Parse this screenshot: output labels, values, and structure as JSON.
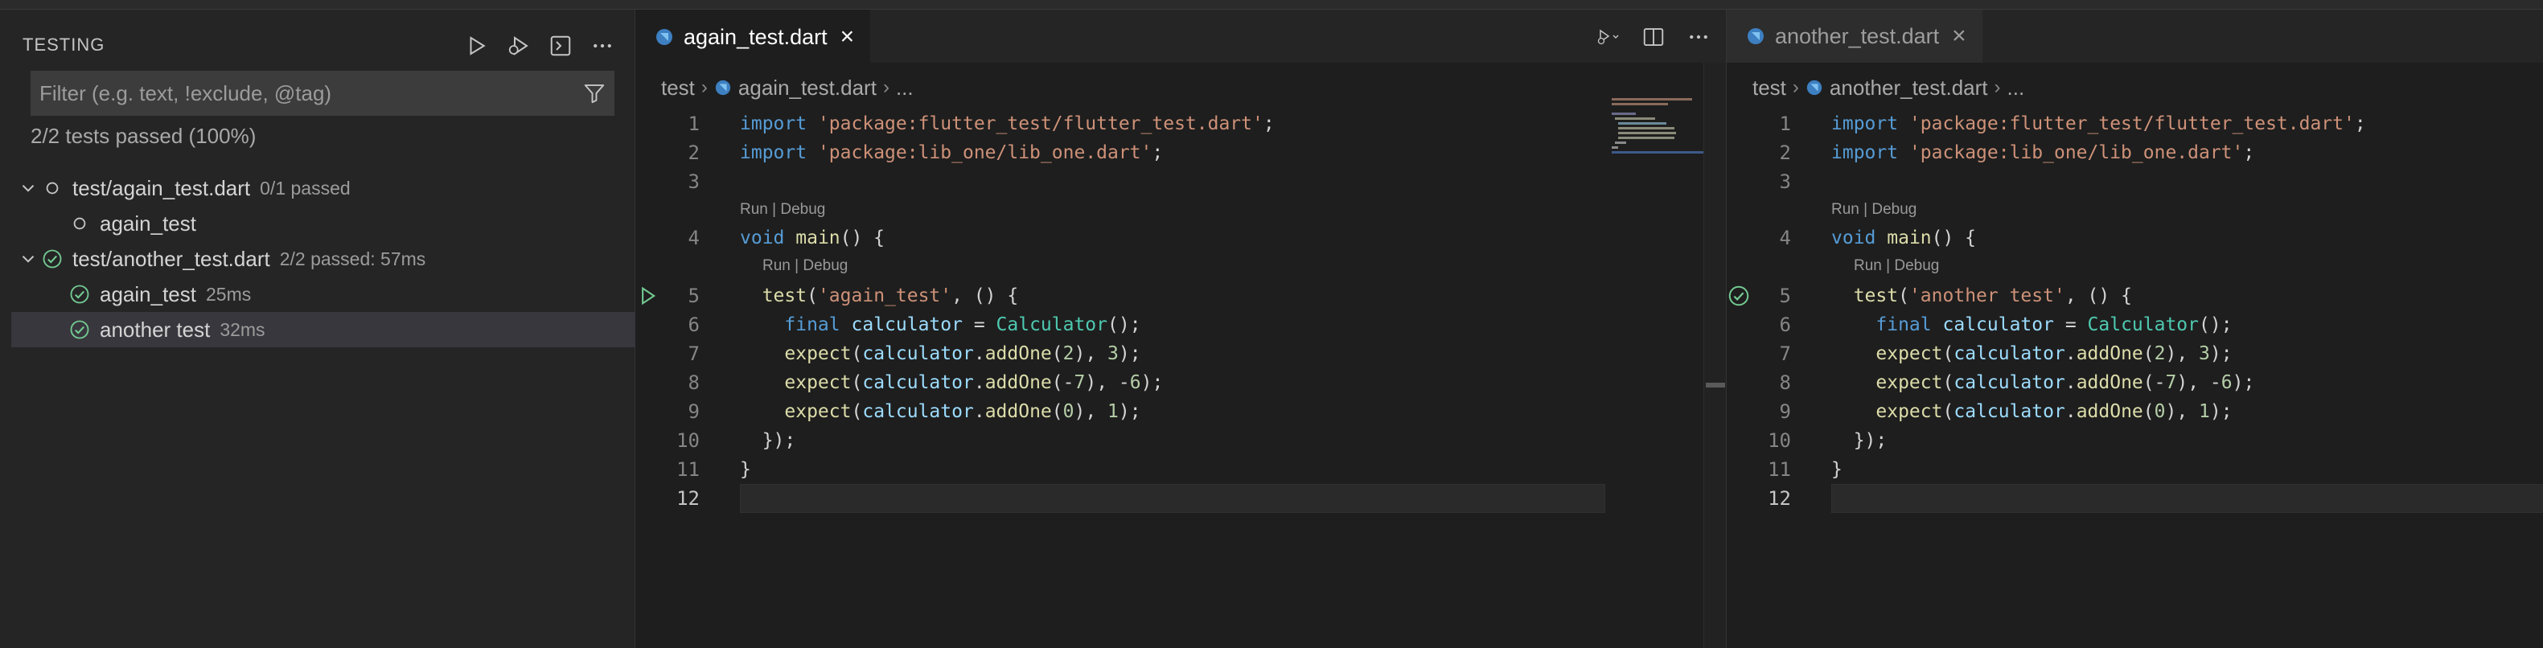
{
  "sidebar": {
    "title": "TESTING",
    "actions": [
      "run-tests-icon",
      "debug-tests-icon",
      "show-output-icon",
      "more-actions-icon"
    ],
    "filter_placeholder": "Filter (e.g. text, !exclude, @tag)",
    "summary": "2/2 tests passed (100%)",
    "tree": [
      {
        "label": "test/again_test.dart",
        "meta": "0/1 passed",
        "status": "unset",
        "expanded": true,
        "level": 0
      },
      {
        "label": "again_test",
        "meta": "",
        "status": "unset",
        "level": 1
      },
      {
        "label": "test/another_test.dart",
        "meta": "2/2 passed: 57ms",
        "status": "passed",
        "expanded": true,
        "level": 0
      },
      {
        "label": "again_test",
        "meta": "25ms",
        "status": "passed",
        "level": 1
      },
      {
        "label": "another test",
        "meta": "32ms",
        "status": "passed",
        "level": 1,
        "selected": true
      }
    ]
  },
  "editor1": {
    "tab": "again_test.dart",
    "crumbs": [
      "test",
      "again_test.dart",
      "..."
    ],
    "lens": "Run | Debug",
    "lines": [
      {
        "n": "1",
        "html": "<span class=\"k\">import</span> <span class=\"s\">'package:flutter_test/flutter_test.dart'</span>;"
      },
      {
        "n": "2",
        "html": "<span class=\"k\">import</span> <span class=\"s\">'package:lib_one/lib_one.dart'</span>;"
      },
      {
        "n": "3",
        "html": ""
      },
      {
        "n": "4",
        "html": "<span class=\"k\">void</span> <span class=\"f\">main</span>() {"
      },
      {
        "n": "5",
        "html": "  <span class=\"f\">test</span>(<span class=\"s\">'again_test'</span>, () {"
      },
      {
        "n": "6",
        "html": "    <span class=\"k\">final</span> <span class=\"v\">calculator</span> = <span class=\"t\">Calculator</span>();"
      },
      {
        "n": "7",
        "html": "    <span class=\"f\">expect</span>(<span class=\"v\">calculator</span>.<span class=\"f\">addOne</span>(<span class=\"n\">2</span>), <span class=\"n\">3</span>);"
      },
      {
        "n": "8",
        "html": "    <span class=\"f\">expect</span>(<span class=\"v\">calculator</span>.<span class=\"f\">addOne</span>(-<span class=\"n\">7</span>), -<span class=\"n\">6</span>);"
      },
      {
        "n": "9",
        "html": "    <span class=\"f\">expect</span>(<span class=\"v\">calculator</span>.<span class=\"f\">addOne</span>(<span class=\"n\">0</span>), <span class=\"n\">1</span>);"
      },
      {
        "n": "10",
        "html": "  });"
      },
      {
        "n": "11",
        "html": "}"
      },
      {
        "n": "12",
        "html": ""
      }
    ]
  },
  "editor2": {
    "tab": "another_test.dart",
    "crumbs": [
      "test",
      "another_test.dart",
      "..."
    ],
    "lens": "Run | Debug",
    "lines": [
      {
        "n": "1",
        "html": "<span class=\"k\">import</span> <span class=\"s\">'package:flutter_test/flutter_test.dart'</span>;"
      },
      {
        "n": "2",
        "html": "<span class=\"k\">import</span> <span class=\"s\">'package:lib_one/lib_one.dart'</span>;"
      },
      {
        "n": "3",
        "html": ""
      },
      {
        "n": "4",
        "html": "<span class=\"k\">void</span> <span class=\"f\">main</span>() {"
      },
      {
        "n": "5",
        "html": "  <span class=\"f\">test</span>(<span class=\"s\">'another test'</span>, () {"
      },
      {
        "n": "6",
        "html": "    <span class=\"k\">final</span> <span class=\"v\">calculator</span> = <span class=\"t\">Calculator</span>();"
      },
      {
        "n": "7",
        "html": "    <span class=\"f\">expect</span>(<span class=\"v\">calculator</span>.<span class=\"f\">addOne</span>(<span class=\"n\">2</span>), <span class=\"n\">3</span>);"
      },
      {
        "n": "8",
        "html": "    <span class=\"f\">expect</span>(<span class=\"v\">calculator</span>.<span class=\"f\">addOne</span>(-<span class=\"n\">7</span>), -<span class=\"n\">6</span>);"
      },
      {
        "n": "9",
        "html": "    <span class=\"f\">expect</span>(<span class=\"v\">calculator</span>.<span class=\"f\">addOne</span>(<span class=\"n\">0</span>), <span class=\"n\">1</span>);"
      },
      {
        "n": "10",
        "html": "  });"
      },
      {
        "n": "11",
        "html": "}"
      },
      {
        "n": "12",
        "html": ""
      }
    ]
  },
  "colors": {
    "pass": "#73c991",
    "unset": "#c5c5c5",
    "accent": "#89d185"
  }
}
